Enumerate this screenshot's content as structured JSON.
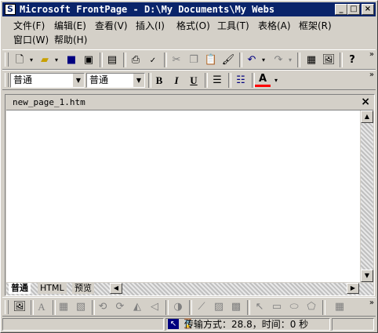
{
  "window": {
    "title": "Microsoft FrontPage - D:\\My Documents\\My Webs",
    "app_icon": "frontpage-logo-icon",
    "controls": [
      "minimize-icon",
      "maximize-icon",
      "close-icon"
    ]
  },
  "menu": {
    "items": [
      {
        "label": "文件(F)"
      },
      {
        "label": "编辑(E)"
      },
      {
        "label": "查看(V)"
      },
      {
        "label": "插入(I)"
      },
      {
        "label": "格式(O)"
      },
      {
        "label": "工具(T)"
      },
      {
        "label": "表格(A)"
      },
      {
        "label": "框架(R)"
      },
      {
        "label": "窗口(W)"
      },
      {
        "label": "帮助(H)"
      }
    ]
  },
  "format_toolbar": {
    "style_value": "普通",
    "font_value": "普通",
    "bold": "B",
    "italic": "I",
    "underline": "U",
    "font_color_letter": "A",
    "font_color": "#ff0000"
  },
  "document": {
    "tab_label": "new_page_1.htm",
    "close_glyph": "×"
  },
  "view_tabs": [
    {
      "label": "普通",
      "active": true
    },
    {
      "label": "HTML",
      "active": false
    },
    {
      "label": "预览",
      "active": false
    }
  ],
  "status": {
    "transfer_text": "传输方式：28.8，时间：0 秒"
  },
  "colors": {
    "title_bar": "#0a246a",
    "face": "#d4d0c8"
  }
}
